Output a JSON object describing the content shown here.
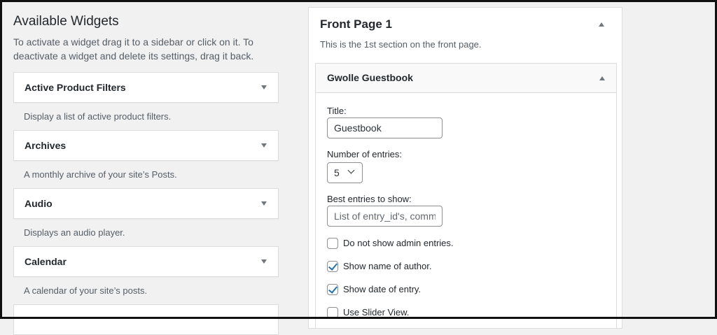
{
  "available": {
    "title": "Available Widgets",
    "description": "To activate a widget drag it to a sidebar or click on it. To deactivate a widget and delete its settings, drag it back."
  },
  "widgets": [
    {
      "name": "Active Product Filters",
      "description": "Display a list of active product filters."
    },
    {
      "name": "Archives",
      "description": "A monthly archive of your site’s Posts."
    },
    {
      "name": "Audio",
      "description": "Displays an audio player."
    },
    {
      "name": "Calendar",
      "description": "A calendar of your site’s posts."
    },
    {
      "name": "",
      "description": ""
    }
  ],
  "sidebar": {
    "title": "Front Page 1",
    "description": "This is the 1st section on the front page."
  },
  "guestbook": {
    "title": "Gwolle Guestbook",
    "fields": {
      "title_label": "Title:",
      "title_value": "Guestbook",
      "entries_label": "Number of entries:",
      "entries_value": "5",
      "best_label": "Best entries to show:",
      "best_placeholder": "List of entry_id's, comma-separated"
    },
    "options": [
      {
        "label": "Do not show admin entries.",
        "checked": false
      },
      {
        "label": "Show name of author.",
        "checked": true
      },
      {
        "label": "Show date of entry.",
        "checked": true
      },
      {
        "label": "Use Slider View.",
        "checked": false
      }
    ]
  },
  "icons": {
    "collapsed": "triangle-down-icon",
    "expanded": "triangle-up-icon"
  }
}
